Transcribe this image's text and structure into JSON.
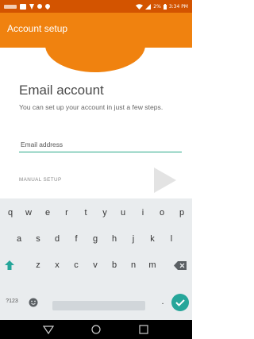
{
  "status_bar": {
    "time": "3:34 PM",
    "battery": "2%"
  },
  "app_bar": {
    "title": "Account setup"
  },
  "screen": {
    "title": "Email account",
    "description": "You can set up your account in just a few steps.",
    "email_field": {
      "placeholder": "Email address",
      "value": ""
    },
    "manual_setup_label": "MANUAL SETUP"
  },
  "keyboard": {
    "row1": [
      "q",
      "w",
      "e",
      "r",
      "t",
      "y",
      "u",
      "i",
      "o",
      "p"
    ],
    "row2": [
      "a",
      "s",
      "d",
      "f",
      "g",
      "h",
      "j",
      "k",
      "l"
    ],
    "row3": [
      "z",
      "x",
      "c",
      "v",
      "b",
      "n",
      "m"
    ],
    "symbols_key": "?123",
    "period_key": "."
  },
  "colors": {
    "accent_orange": "#f0820f",
    "status_orange": "#d35400",
    "accent_teal": "#26a69a"
  },
  "icons": {
    "shift": "shift-icon",
    "backspace": "backspace-icon",
    "emoji": "emoji-icon",
    "enter": "check-icon",
    "next": "arrow-right-icon",
    "nav_back": "back-icon",
    "nav_home": "home-icon",
    "nav_recents": "recents-icon"
  }
}
